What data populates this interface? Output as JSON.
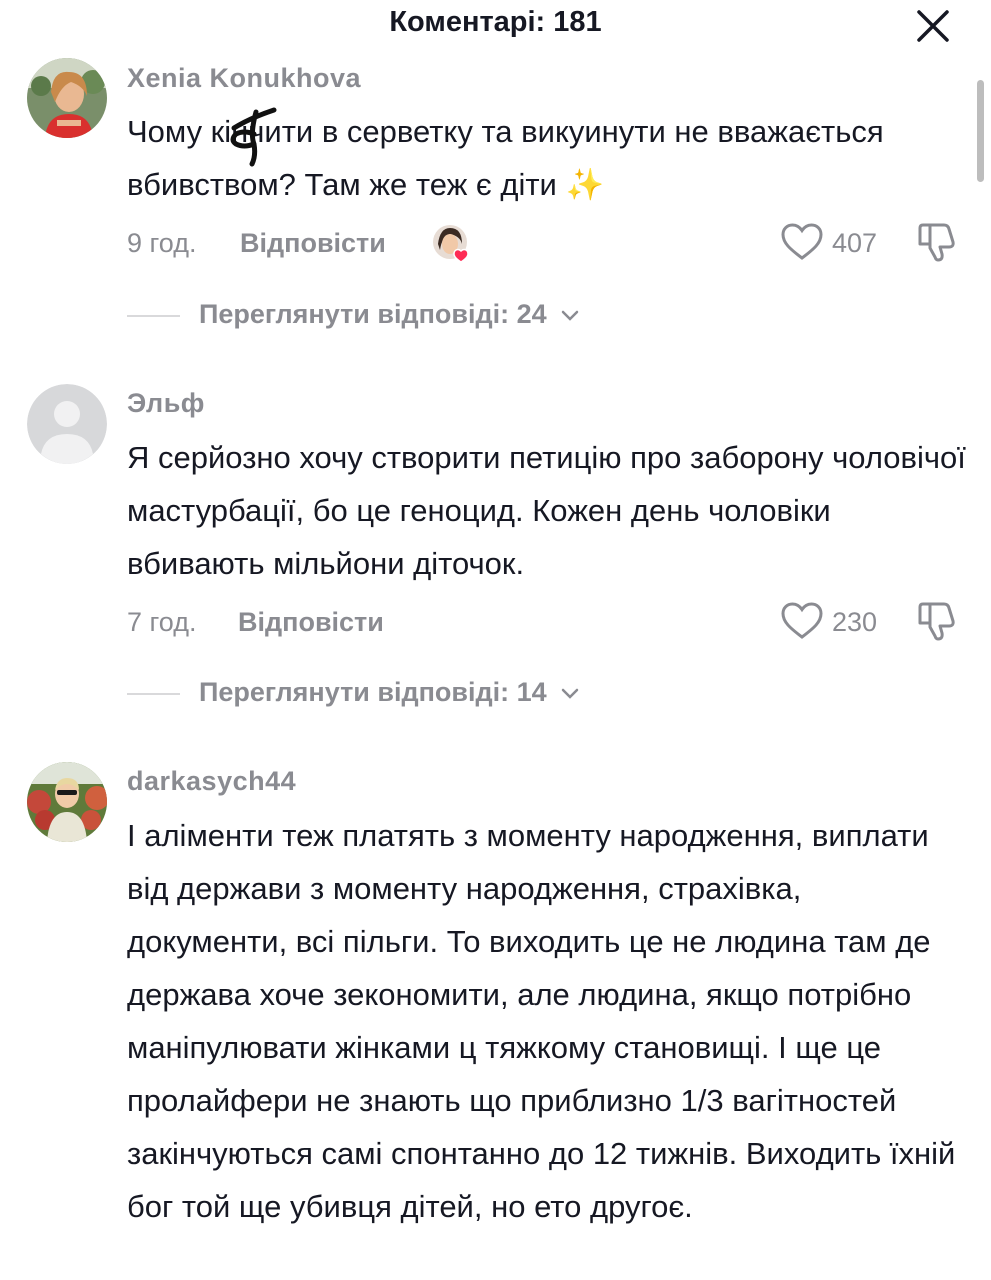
{
  "header": {
    "title": "Коментарі: 181",
    "close_icon": "close-icon"
  },
  "comments": [
    {
      "username": "Xenia Konukhova",
      "avatar_icon": "user-avatar",
      "text": "Чому кінчити в серветку та викуинути не вважається вбивством? Там же теж є діти ✨",
      "time": "9 год.",
      "reply_label": "Відповісти",
      "likes": "407",
      "creator_liked": true,
      "view_replies": "Переглянути відповіді: 24"
    },
    {
      "username": "Эльф",
      "avatar_icon": "default-avatar-icon",
      "text": "Я серйозно хочу створити петицію про заборону чоловічої мастурбації, бо це геноцид. Кожен день чоловіки вбивають мільйони діточок.",
      "time": "7 год.",
      "reply_label": "Відповісти",
      "likes": "230",
      "view_replies": "Переглянути відповіді: 14"
    },
    {
      "username": "darkasych44",
      "avatar_icon": "user-avatar",
      "text": "І аліменти теж платять з моменту народження, виплати від держави з моменту народження, страхівка, документи, всі пільги. То виходить це не людина там де держава хоче зекономити, але людина, якщо потрібно маніпулювати жінками ц тяжкому становищі. І ще це пролайфери не знають що приблизно 1/3 вагітностей закінчуються самі спонтанно до 12 тижнів. Виходить їхній бог той ще убивця дітей, но ето другоє."
    }
  ],
  "colors": {
    "text": "#161823",
    "muted": "#8a8b91",
    "like_heart_badge": "#fe2c55"
  }
}
